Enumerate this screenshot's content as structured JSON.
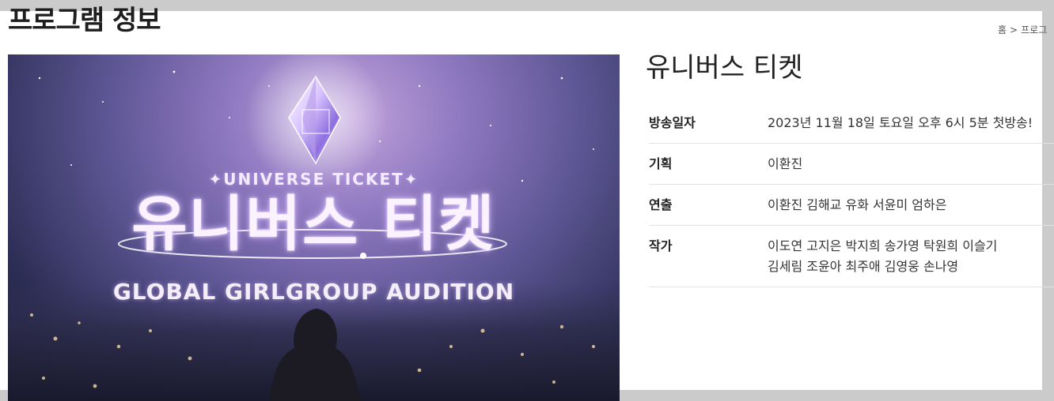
{
  "page": {
    "title": "프로그램 정보"
  },
  "breadcrumb": {
    "items": [
      "홈",
      ">",
      "프로그"
    ]
  },
  "poster": {
    "subtitle": "✦UNIVERSE TICKET✦",
    "title": "유니버스 티켓",
    "tagline": "GLOBAL GIRLGROUP AUDITION"
  },
  "program": {
    "name": "유니버스 티켓",
    "info": [
      {
        "label": "방송일자",
        "value": "2023년 11월 18일 토요일 오후 6시 5분 첫방송!"
      },
      {
        "label": "기획",
        "value": "이환진"
      },
      {
        "label": "연출",
        "value": "이환진 김해교 유화 서윤미 엄하은"
      },
      {
        "label": "작가",
        "value": "이도연 고지은 박지희 송가영 탁원희 이슬기",
        "value2": "김세림 조윤아 최주애 김영웅 손나영"
      }
    ]
  },
  "colors": {
    "background": "#cbcbcb",
    "panel": "#ffffff",
    "text": "#222222"
  }
}
